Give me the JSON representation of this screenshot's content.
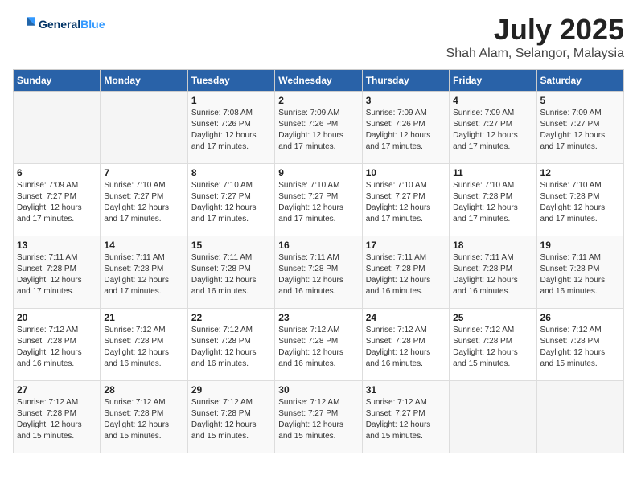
{
  "logo": {
    "line1": "General",
    "line2": "Blue"
  },
  "header": {
    "month": "July 2025",
    "location": "Shah Alam, Selangor, Malaysia"
  },
  "weekdays": [
    "Sunday",
    "Monday",
    "Tuesday",
    "Wednesday",
    "Thursday",
    "Friday",
    "Saturday"
  ],
  "weeks": [
    [
      {
        "day": "",
        "sunrise": "",
        "sunset": "",
        "daylight": ""
      },
      {
        "day": "",
        "sunrise": "",
        "sunset": "",
        "daylight": ""
      },
      {
        "day": "1",
        "sunrise": "Sunrise: 7:08 AM",
        "sunset": "Sunset: 7:26 PM",
        "daylight": "Daylight: 12 hours and 17 minutes."
      },
      {
        "day": "2",
        "sunrise": "Sunrise: 7:09 AM",
        "sunset": "Sunset: 7:26 PM",
        "daylight": "Daylight: 12 hours and 17 minutes."
      },
      {
        "day": "3",
        "sunrise": "Sunrise: 7:09 AM",
        "sunset": "Sunset: 7:26 PM",
        "daylight": "Daylight: 12 hours and 17 minutes."
      },
      {
        "day": "4",
        "sunrise": "Sunrise: 7:09 AM",
        "sunset": "Sunset: 7:27 PM",
        "daylight": "Daylight: 12 hours and 17 minutes."
      },
      {
        "day": "5",
        "sunrise": "Sunrise: 7:09 AM",
        "sunset": "Sunset: 7:27 PM",
        "daylight": "Daylight: 12 hours and 17 minutes."
      }
    ],
    [
      {
        "day": "6",
        "sunrise": "Sunrise: 7:09 AM",
        "sunset": "Sunset: 7:27 PM",
        "daylight": "Daylight: 12 hours and 17 minutes."
      },
      {
        "day": "7",
        "sunrise": "Sunrise: 7:10 AM",
        "sunset": "Sunset: 7:27 PM",
        "daylight": "Daylight: 12 hours and 17 minutes."
      },
      {
        "day": "8",
        "sunrise": "Sunrise: 7:10 AM",
        "sunset": "Sunset: 7:27 PM",
        "daylight": "Daylight: 12 hours and 17 minutes."
      },
      {
        "day": "9",
        "sunrise": "Sunrise: 7:10 AM",
        "sunset": "Sunset: 7:27 PM",
        "daylight": "Daylight: 12 hours and 17 minutes."
      },
      {
        "day": "10",
        "sunrise": "Sunrise: 7:10 AM",
        "sunset": "Sunset: 7:27 PM",
        "daylight": "Daylight: 12 hours and 17 minutes."
      },
      {
        "day": "11",
        "sunrise": "Sunrise: 7:10 AM",
        "sunset": "Sunset: 7:28 PM",
        "daylight": "Daylight: 12 hours and 17 minutes."
      },
      {
        "day": "12",
        "sunrise": "Sunrise: 7:10 AM",
        "sunset": "Sunset: 7:28 PM",
        "daylight": "Daylight: 12 hours and 17 minutes."
      }
    ],
    [
      {
        "day": "13",
        "sunrise": "Sunrise: 7:11 AM",
        "sunset": "Sunset: 7:28 PM",
        "daylight": "Daylight: 12 hours and 17 minutes."
      },
      {
        "day": "14",
        "sunrise": "Sunrise: 7:11 AM",
        "sunset": "Sunset: 7:28 PM",
        "daylight": "Daylight: 12 hours and 17 minutes."
      },
      {
        "day": "15",
        "sunrise": "Sunrise: 7:11 AM",
        "sunset": "Sunset: 7:28 PM",
        "daylight": "Daylight: 12 hours and 16 minutes."
      },
      {
        "day": "16",
        "sunrise": "Sunrise: 7:11 AM",
        "sunset": "Sunset: 7:28 PM",
        "daylight": "Daylight: 12 hours and 16 minutes."
      },
      {
        "day": "17",
        "sunrise": "Sunrise: 7:11 AM",
        "sunset": "Sunset: 7:28 PM",
        "daylight": "Daylight: 12 hours and 16 minutes."
      },
      {
        "day": "18",
        "sunrise": "Sunrise: 7:11 AM",
        "sunset": "Sunset: 7:28 PM",
        "daylight": "Daylight: 12 hours and 16 minutes."
      },
      {
        "day": "19",
        "sunrise": "Sunrise: 7:11 AM",
        "sunset": "Sunset: 7:28 PM",
        "daylight": "Daylight: 12 hours and 16 minutes."
      }
    ],
    [
      {
        "day": "20",
        "sunrise": "Sunrise: 7:12 AM",
        "sunset": "Sunset: 7:28 PM",
        "daylight": "Daylight: 12 hours and 16 minutes."
      },
      {
        "day": "21",
        "sunrise": "Sunrise: 7:12 AM",
        "sunset": "Sunset: 7:28 PM",
        "daylight": "Daylight: 12 hours and 16 minutes."
      },
      {
        "day": "22",
        "sunrise": "Sunrise: 7:12 AM",
        "sunset": "Sunset: 7:28 PM",
        "daylight": "Daylight: 12 hours and 16 minutes."
      },
      {
        "day": "23",
        "sunrise": "Sunrise: 7:12 AM",
        "sunset": "Sunset: 7:28 PM",
        "daylight": "Daylight: 12 hours and 16 minutes."
      },
      {
        "day": "24",
        "sunrise": "Sunrise: 7:12 AM",
        "sunset": "Sunset: 7:28 PM",
        "daylight": "Daylight: 12 hours and 16 minutes."
      },
      {
        "day": "25",
        "sunrise": "Sunrise: 7:12 AM",
        "sunset": "Sunset: 7:28 PM",
        "daylight": "Daylight: 12 hours and 15 minutes."
      },
      {
        "day": "26",
        "sunrise": "Sunrise: 7:12 AM",
        "sunset": "Sunset: 7:28 PM",
        "daylight": "Daylight: 12 hours and 15 minutes."
      }
    ],
    [
      {
        "day": "27",
        "sunrise": "Sunrise: 7:12 AM",
        "sunset": "Sunset: 7:28 PM",
        "daylight": "Daylight: 12 hours and 15 minutes."
      },
      {
        "day": "28",
        "sunrise": "Sunrise: 7:12 AM",
        "sunset": "Sunset: 7:28 PM",
        "daylight": "Daylight: 12 hours and 15 minutes."
      },
      {
        "day": "29",
        "sunrise": "Sunrise: 7:12 AM",
        "sunset": "Sunset: 7:28 PM",
        "daylight": "Daylight: 12 hours and 15 minutes."
      },
      {
        "day": "30",
        "sunrise": "Sunrise: 7:12 AM",
        "sunset": "Sunset: 7:27 PM",
        "daylight": "Daylight: 12 hours and 15 minutes."
      },
      {
        "day": "31",
        "sunrise": "Sunrise: 7:12 AM",
        "sunset": "Sunset: 7:27 PM",
        "daylight": "Daylight: 12 hours and 15 minutes."
      },
      {
        "day": "",
        "sunrise": "",
        "sunset": "",
        "daylight": ""
      },
      {
        "day": "",
        "sunrise": "",
        "sunset": "",
        "daylight": ""
      }
    ]
  ]
}
